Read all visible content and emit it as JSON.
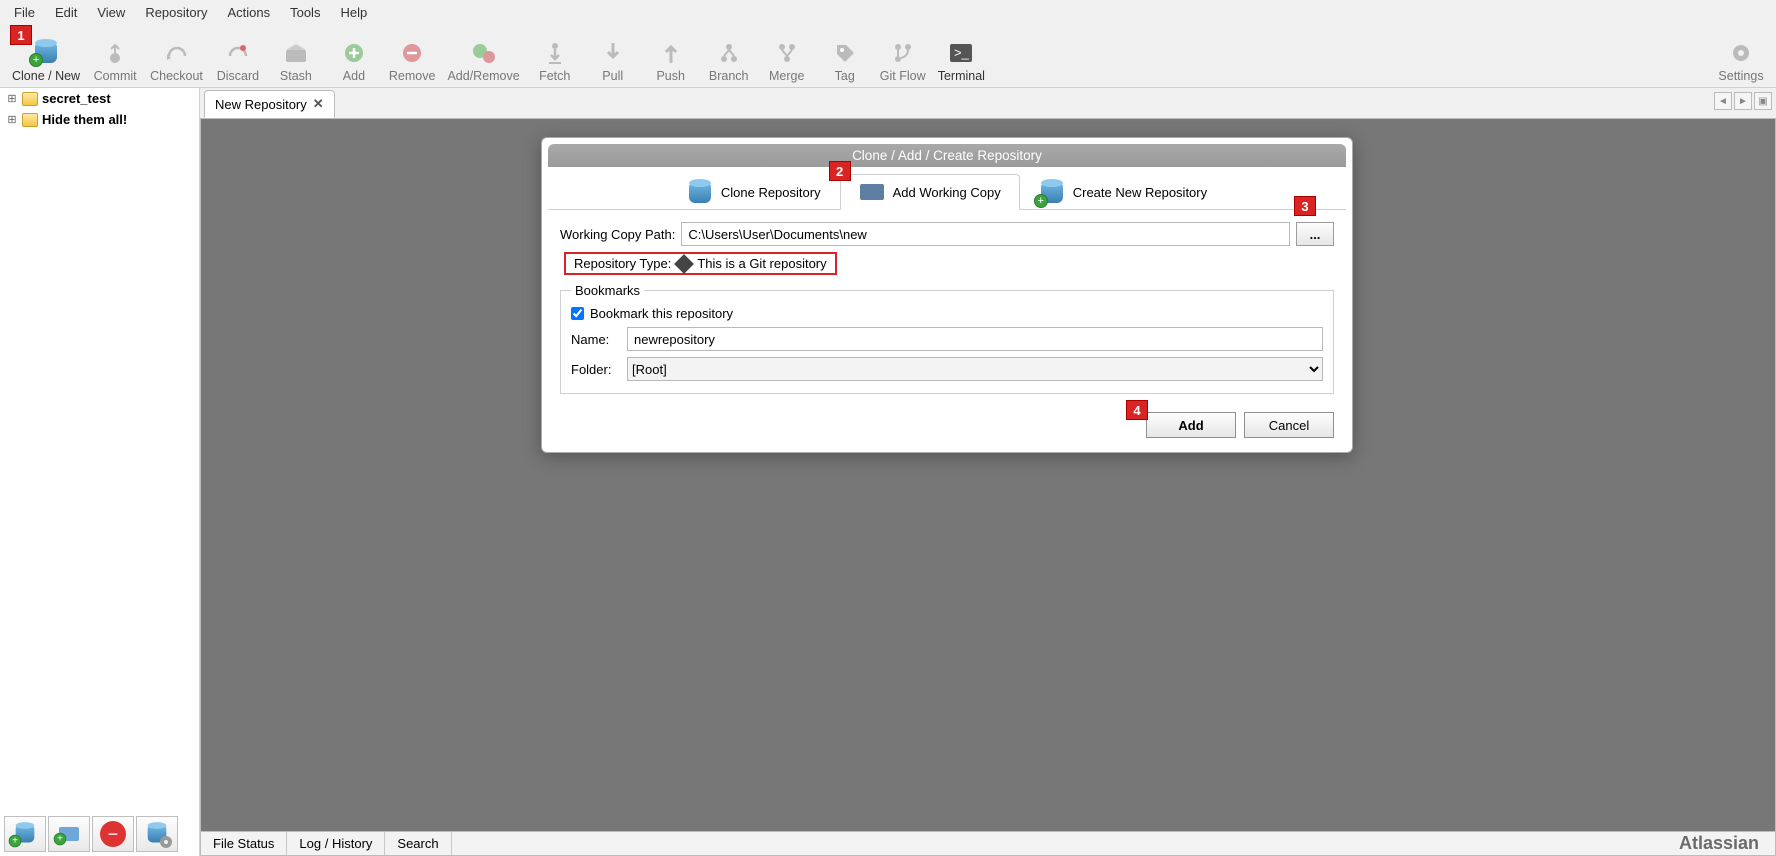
{
  "menu": [
    "File",
    "Edit",
    "View",
    "Repository",
    "Actions",
    "Tools",
    "Help"
  ],
  "toolbar": [
    {
      "label": "Clone / New",
      "enabled": true
    },
    {
      "label": "Commit",
      "enabled": false
    },
    {
      "label": "Checkout",
      "enabled": false
    },
    {
      "label": "Discard",
      "enabled": false
    },
    {
      "label": "Stash",
      "enabled": false
    },
    {
      "label": "Add",
      "enabled": false
    },
    {
      "label": "Remove",
      "enabled": false
    },
    {
      "label": "Add/Remove",
      "enabled": false
    },
    {
      "label": "Fetch",
      "enabled": false
    },
    {
      "label": "Pull",
      "enabled": false
    },
    {
      "label": "Push",
      "enabled": false
    },
    {
      "label": "Branch",
      "enabled": false
    },
    {
      "label": "Merge",
      "enabled": false
    },
    {
      "label": "Tag",
      "enabled": false
    },
    {
      "label": "Git Flow",
      "enabled": false
    },
    {
      "label": "Terminal",
      "enabled": true
    }
  ],
  "settings_label": "Settings",
  "tree": [
    {
      "name": "secret_test"
    },
    {
      "name": "Hide them all!"
    }
  ],
  "tab": {
    "title": "New Repository"
  },
  "dialog": {
    "title": "Clone  / Add / Create Repository",
    "tabs": [
      "Clone Repository",
      "Add Working Copy",
      "Create New Repository"
    ],
    "active_tab": 1,
    "path_label": "Working Copy Path:",
    "path_value": "C:\\Users\\User\\Documents\\new",
    "browse": "...",
    "repotype_label": "Repository Type:",
    "repotype_value": "This is a Git repository",
    "bookmarks_legend": "Bookmarks",
    "bookmark_cb": "Bookmark this repository",
    "bookmark_checked": true,
    "name_label": "Name:",
    "name_value": "newrepository",
    "folder_label": "Folder:",
    "folder_value": "[Root]",
    "add": "Add",
    "cancel": "Cancel"
  },
  "status": {
    "file": "File Status",
    "log": "Log / History",
    "search": "Search",
    "brand": "Atlassian"
  },
  "markers": {
    "1": "1",
    "2": "2",
    "3": "3",
    "4": "4"
  }
}
